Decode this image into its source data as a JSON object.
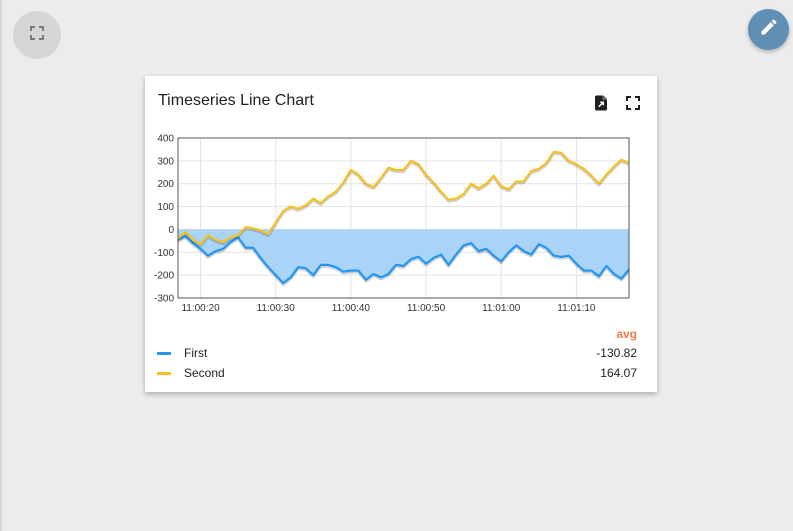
{
  "widget": {
    "title": "Timeseries Line Chart"
  },
  "icons": {
    "dashboard_fullscreen": "fullscreen-icon",
    "edit": "pencil-icon",
    "export": "file-export-icon",
    "widget_fullscreen": "fullscreen-icon"
  },
  "colors": {
    "first": "#2196f3",
    "first_fill": "#a9d3f7",
    "second": "#f5c022",
    "edit_button": "#5f8fb5",
    "avg_header": "#f07e43"
  },
  "legend": {
    "header": "avg",
    "items": [
      {
        "label": "First",
        "value": "-130.82"
      },
      {
        "label": "Second",
        "value": "164.07"
      }
    ]
  },
  "chart_data": {
    "type": "line",
    "ylim": [
      -300,
      400
    ],
    "y_ticks": [
      400,
      300,
      200,
      100,
      0,
      -100,
      -200,
      -300
    ],
    "x_range": [
      "11:00:17",
      "11:01:17"
    ],
    "x_ticks": [
      "11:00:20",
      "11:00:30",
      "11:00:40",
      "11:00:50",
      "11:01:00",
      "11:01:10"
    ],
    "grid": true,
    "series": [
      {
        "name": "First",
        "fill": true,
        "points": [
          [
            "11:00:17",
            -45
          ],
          [
            "11:00:18",
            -30
          ],
          [
            "11:00:19",
            -60
          ],
          [
            "11:00:20",
            -85
          ],
          [
            "11:00:21",
            -115
          ],
          [
            "11:00:22",
            -95
          ],
          [
            "11:00:23",
            -85
          ],
          [
            "11:00:24",
            -55
          ],
          [
            "11:00:25",
            -35
          ],
          [
            "11:00:26",
            -80
          ],
          [
            "11:00:27",
            -80
          ],
          [
            "11:00:28",
            -125
          ],
          [
            "11:00:29",
            -165
          ],
          [
            "11:00:30",
            -200
          ],
          [
            "11:00:31",
            -235
          ],
          [
            "11:00:32",
            -210
          ],
          [
            "11:00:33",
            -165
          ],
          [
            "11:00:34",
            -170
          ],
          [
            "11:00:35",
            -200
          ],
          [
            "11:00:36",
            -155
          ],
          [
            "11:00:37",
            -155
          ],
          [
            "11:00:38",
            -165
          ],
          [
            "11:00:39",
            -185
          ],
          [
            "11:00:40",
            -180
          ],
          [
            "11:00:41",
            -180
          ],
          [
            "11:00:42",
            -220
          ],
          [
            "11:00:43",
            -195
          ],
          [
            "11:00:44",
            -210
          ],
          [
            "11:00:45",
            -195
          ],
          [
            "11:00:46",
            -155
          ],
          [
            "11:00:47",
            -160
          ],
          [
            "11:00:48",
            -130
          ],
          [
            "11:00:49",
            -120
          ],
          [
            "11:00:50",
            -150
          ],
          [
            "11:00:51",
            -125
          ],
          [
            "11:00:52",
            -110
          ],
          [
            "11:00:53",
            -155
          ],
          [
            "11:00:54",
            -110
          ],
          [
            "11:00:55",
            -70
          ],
          [
            "11:00:56",
            -60
          ],
          [
            "11:00:57",
            -95
          ],
          [
            "11:00:58",
            -85
          ],
          [
            "11:00:59",
            -115
          ],
          [
            "11:01:00",
            -140
          ],
          [
            "11:01:01",
            -100
          ],
          [
            "11:01:02",
            -70
          ],
          [
            "11:01:03",
            -95
          ],
          [
            "11:01:04",
            -110
          ],
          [
            "11:01:05",
            -65
          ],
          [
            "11:01:06",
            -80
          ],
          [
            "11:01:07",
            -115
          ],
          [
            "11:01:08",
            -120
          ],
          [
            "11:01:09",
            -115
          ],
          [
            "11:01:10",
            -150
          ],
          [
            "11:01:11",
            -180
          ],
          [
            "11:01:12",
            -180
          ],
          [
            "11:01:13",
            -205
          ],
          [
            "11:01:14",
            -160
          ],
          [
            "11:01:15",
            -195
          ],
          [
            "11:01:16",
            -215
          ],
          [
            "11:01:17",
            -175
          ]
        ]
      },
      {
        "name": "Second",
        "fill": false,
        "points": [
          [
            "11:00:17",
            -40
          ],
          [
            "11:00:18",
            -10
          ],
          [
            "11:00:19",
            -45
          ],
          [
            "11:00:20",
            -65
          ],
          [
            "11:00:21",
            -25
          ],
          [
            "11:00:22",
            -45
          ],
          [
            "11:00:23",
            -55
          ],
          [
            "11:00:24",
            -35
          ],
          [
            "11:00:25",
            -25
          ],
          [
            "11:00:26",
            10
          ],
          [
            "11:00:27",
            5
          ],
          [
            "11:00:28",
            -5
          ],
          [
            "11:00:29",
            -20
          ],
          [
            "11:00:30",
            30
          ],
          [
            "11:00:31",
            80
          ],
          [
            "11:00:32",
            100
          ],
          [
            "11:00:33",
            90
          ],
          [
            "11:00:34",
            105
          ],
          [
            "11:00:35",
            135
          ],
          [
            "11:00:36",
            115
          ],
          [
            "11:00:37",
            145
          ],
          [
            "11:00:38",
            165
          ],
          [
            "11:00:39",
            205
          ],
          [
            "11:00:40",
            260
          ],
          [
            "11:00:41",
            240
          ],
          [
            "11:00:42",
            200
          ],
          [
            "11:00:43",
            185
          ],
          [
            "11:00:44",
            225
          ],
          [
            "11:00:45",
            270
          ],
          [
            "11:00:46",
            260
          ],
          [
            "11:00:47",
            260
          ],
          [
            "11:00:48",
            300
          ],
          [
            "11:00:49",
            285
          ],
          [
            "11:00:50",
            240
          ],
          [
            "11:00:51",
            205
          ],
          [
            "11:00:52",
            165
          ],
          [
            "11:00:53",
            130
          ],
          [
            "11:00:54",
            135
          ],
          [
            "11:00:55",
            155
          ],
          [
            "11:00:56",
            200
          ],
          [
            "11:00:57",
            180
          ],
          [
            "11:00:58",
            200
          ],
          [
            "11:00:59",
            235
          ],
          [
            "11:01:00",
            190
          ],
          [
            "11:01:01",
            175
          ],
          [
            "11:01:02",
            210
          ],
          [
            "11:01:03",
            210
          ],
          [
            "11:01:04",
            255
          ],
          [
            "11:01:05",
            265
          ],
          [
            "11:01:06",
            290
          ],
          [
            "11:01:07",
            340
          ],
          [
            "11:01:08",
            335
          ],
          [
            "11:01:09",
            300
          ],
          [
            "11:01:10",
            285
          ],
          [
            "11:01:11",
            265
          ],
          [
            "11:01:12",
            235
          ],
          [
            "11:01:13",
            200
          ],
          [
            "11:01:14",
            240
          ],
          [
            "11:01:15",
            275
          ],
          [
            "11:01:16",
            305
          ],
          [
            "11:01:17",
            290
          ]
        ]
      }
    ]
  }
}
